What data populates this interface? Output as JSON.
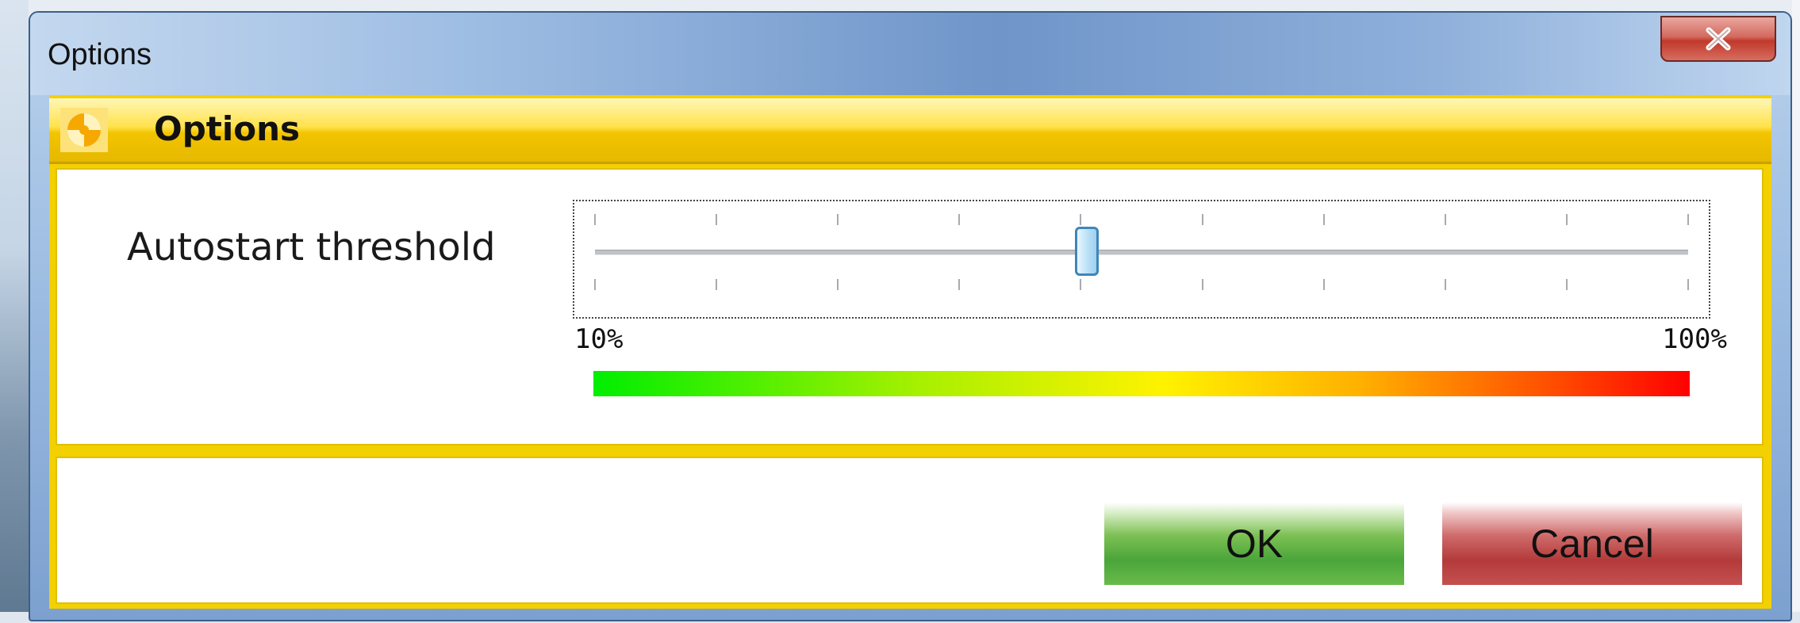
{
  "window": {
    "title": "Options"
  },
  "panel": {
    "header_title": "Options"
  },
  "settings": {
    "autostart_label": "Autostart threshold",
    "slider": {
      "min_label": "10%",
      "max_label": "100%",
      "value_fraction": 0.45,
      "tick_count": 10
    }
  },
  "buttons": {
    "ok": "OK",
    "cancel": "Cancel"
  },
  "icons": {
    "close": "close-icon",
    "header": "options-logo-icon"
  },
  "colors": {
    "titlebar": "#7ca0cf",
    "panel_accent": "#f3d000",
    "ok_button": "#4aa53a",
    "cancel_button": "#b43a3a",
    "close_button": "#c0392b",
    "slider_thumb_border": "#3f86b8"
  }
}
